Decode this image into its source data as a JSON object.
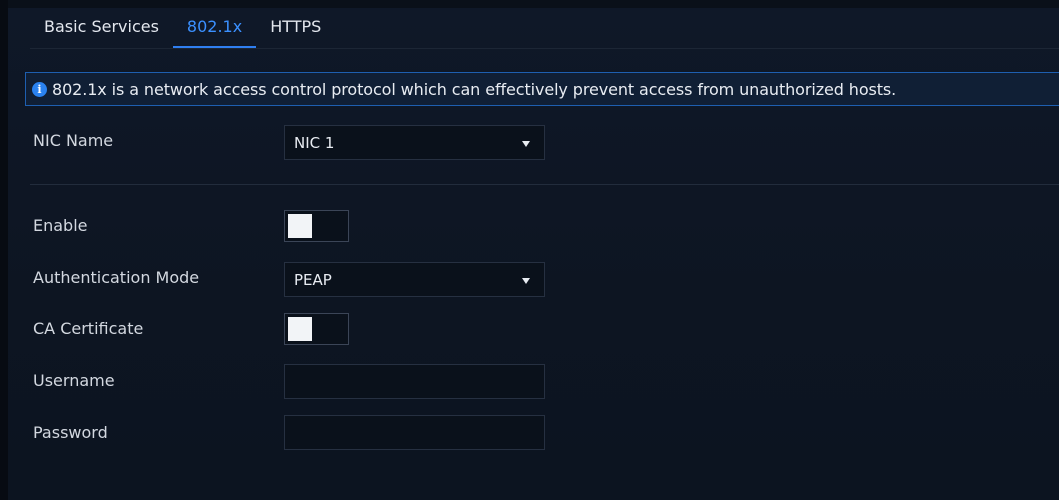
{
  "tabs": [
    {
      "label": "Basic Services",
      "active": false
    },
    {
      "label": "802.1x",
      "active": true
    },
    {
      "label": "HTTPS",
      "active": false
    }
  ],
  "info": {
    "icon": "info-icon",
    "text": "802.1x is a network access control protocol which can effectively prevent access from unauthorized hosts."
  },
  "form": {
    "nic_name": {
      "label": "NIC Name",
      "value": "NIC 1"
    },
    "enable": {
      "label": "Enable",
      "on": false
    },
    "auth_mode": {
      "label": "Authentication Mode",
      "value": "PEAP"
    },
    "ca_certificate": {
      "label": "CA Certificate",
      "on": false
    },
    "username": {
      "label": "Username",
      "value": ""
    },
    "password": {
      "label": "Password",
      "value": ""
    }
  },
  "colors": {
    "accent": "#2f7ff0",
    "background": "#0d1522",
    "banner_border": "#1e5fb0"
  }
}
